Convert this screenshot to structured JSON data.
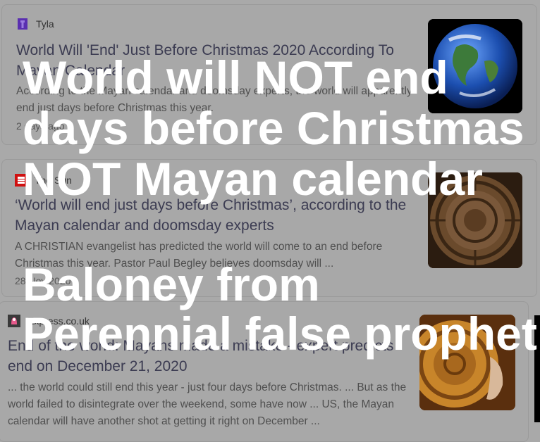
{
  "results": [
    {
      "source": "Tyla",
      "headline": "World Will 'End' Just Before Christmas 2020 According To Mayan Calendar",
      "snippet": "According to the Mayan calendar and doomsday experts, the world will apparently end just days before Christmas this year.",
      "time": "2 days ago",
      "icon": "tyla-logo-icon",
      "thumb": "earth-image"
    },
    {
      "source": "The Sun",
      "headline": "‘World will end just days before Christmas’, according to the Mayan calendar and doomsday experts",
      "snippet": "A CHRISTIAN evangelist has predicted the world will come to an end before Christmas this year. Pastor Paul Begley believes doomsday will ...",
      "time": "28 Nov 2020",
      "icon": "the-sun-logo-icon",
      "thumb": "mayan-calendar-stone-image"
    },
    {
      "source": "Express.co.uk",
      "headline": "End of the world: Mayans made a mistake - expert predicts end on December 21, 2020",
      "snippet": "... the world could still end this year - just four days before Christmas. ... But as the world failed to disintegrate over the weekend, some have now ... US, the Mayan calendar will have another shot at getting it right on December ...",
      "icon": "express-logo-icon",
      "thumb": "mayan-calendar-gold-image"
    }
  ],
  "overlay": {
    "line1": "World will NOT end",
    "line2": "days before Christmas",
    "line3": "NOT Mayan calendar",
    "line4": "Baloney from",
    "line5": "Perennial false prophet"
  },
  "colors": {
    "background": "#a9a9a9",
    "overlay_text": "#ffffff",
    "headline": "#3c3c52",
    "the_sun_red": "#d01010"
  }
}
